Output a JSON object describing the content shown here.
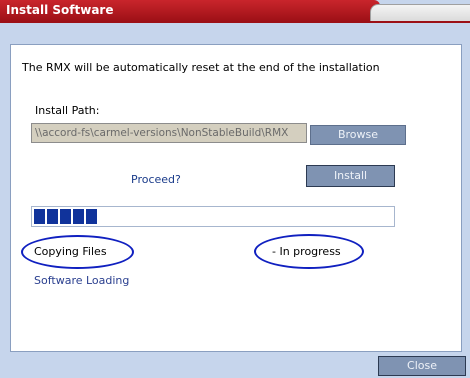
{
  "window": {
    "title": "Install Software"
  },
  "content": {
    "reset_message": "The RMX will be automatically reset at the end of the installation",
    "install_path_label": "Install Path:",
    "install_path_value": "\\\\accord-fs\\carmel-versions\\NonStableBuild\\RMX",
    "browse_label": "Browse",
    "proceed_label": "Proceed?",
    "install_label": "Install",
    "progress": {
      "filled_blocks": 5
    },
    "status_step": "Copying Files",
    "status_state": "- In progress",
    "status_detail": "Software Loading"
  },
  "footer": {
    "close_label": "Close"
  },
  "colors": {
    "title_red": "#c9252c",
    "window_bg": "#c6d5ec",
    "button_bg": "#7f93b2",
    "progress_fill": "#10339b",
    "annotation_ellipse": "#1020c0"
  }
}
